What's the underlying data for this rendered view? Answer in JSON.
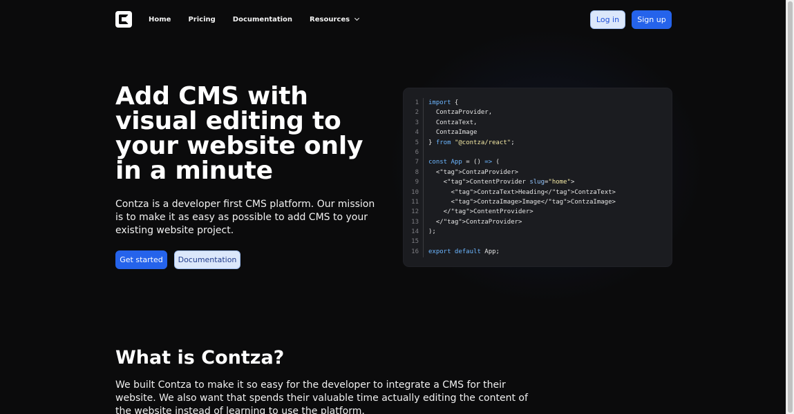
{
  "nav": {
    "logo_letter": "C",
    "links": [
      "Home",
      "Pricing",
      "Documentation"
    ],
    "resources_label": "Resources",
    "login_label": "Log in",
    "signup_label": "Sign up"
  },
  "hero": {
    "title": "Add CMS with visual editing to your website only in a minute",
    "description": "Contza is a developer first CMS platform. Our mission is to make it as easy as possible to add CMS to your existing website project.",
    "primary_button": "Get started",
    "secondary_button": "Documentation"
  },
  "code": {
    "line_numbers": [
      "1",
      "2",
      "3",
      "4",
      "5",
      "6",
      "7",
      "8",
      "9",
      "10",
      "11",
      "12",
      "13",
      "14",
      "15",
      "16"
    ],
    "lines": [
      "import {",
      "  ContzaProvider,",
      "  ContzaText,",
      "  ContzaImage",
      "} from \"@contza/react\";",
      "",
      "const App = () => (",
      "  <ContzaProvider>",
      "    <ContentProvider slug=\"home\">",
      "      <ContzaText>Heading</ContzaText>",
      "      <ContzaImage>Image</ContzaImage>",
      "    </ContentProvider>",
      "  </ContzaProvider>",
      ");",
      "",
      "export default App;"
    ]
  },
  "about": {
    "title": "What is Contza?",
    "description": "We built Contza to make it so easy for the developer to integrate a CMS for their website. We also want that spends their valuable time actually editing the content of the website instead of learning to use the platform."
  },
  "colors": {
    "background": "#0b0b0c",
    "primary": "#2563eb",
    "secondary_bg": "#dbe7fb",
    "code_bg": "#1b1c20"
  }
}
